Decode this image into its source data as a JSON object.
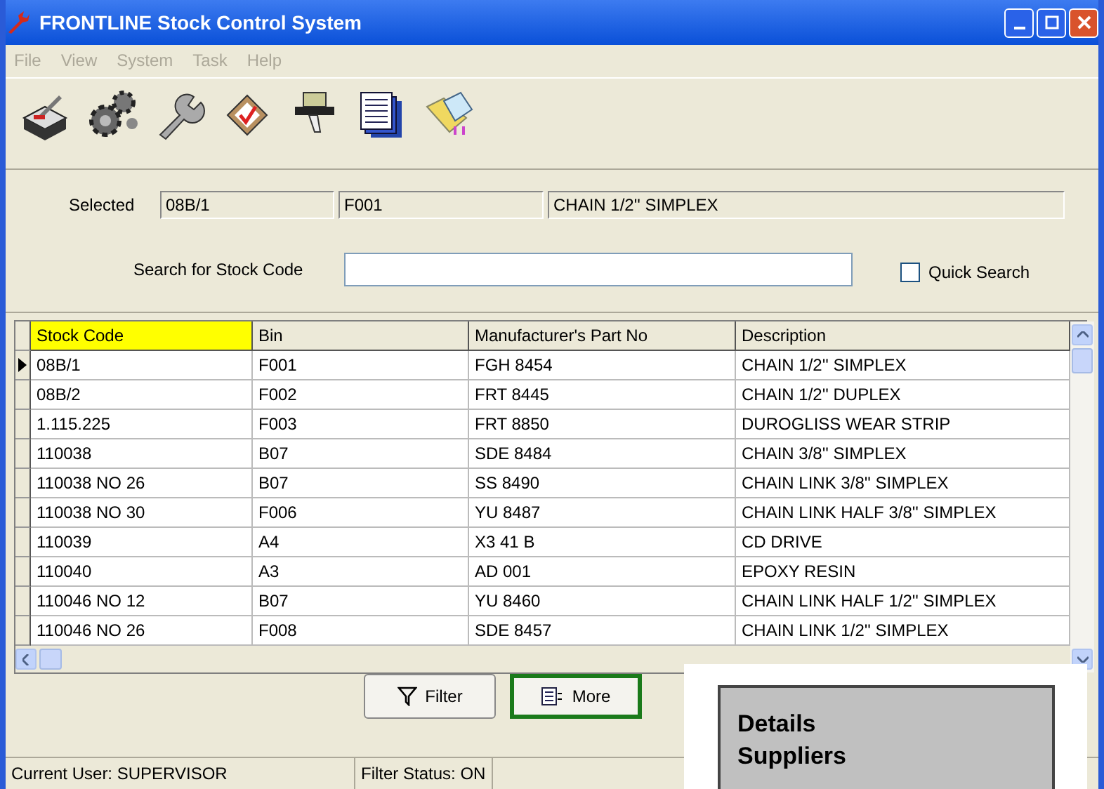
{
  "window": {
    "title": "FRONTLINE Stock Control System"
  },
  "menu": [
    "File",
    "View",
    "System",
    "Task",
    "Help"
  ],
  "selected": {
    "label": "Selected",
    "fields": [
      "08B/1",
      "F001",
      "CHAIN 1/2'' SIMPLEX"
    ]
  },
  "search": {
    "label": "Search for Stock Code",
    "quick_search": {
      "label": "Quick Search",
      "checked": false
    }
  },
  "table": {
    "columns": [
      {
        "label": "Stock Code",
        "sorted": true
      },
      {
        "label": "Bin",
        "sorted": false
      },
      {
        "label": "Manufacturer's Part No",
        "sorted": false
      },
      {
        "label": "Description",
        "sorted": false
      }
    ],
    "rows": [
      {
        "selected": true,
        "cells": [
          "08B/1",
          "F001",
          "FGH  8454",
          "CHAIN 1/2'' SIMPLEX"
        ]
      },
      {
        "selected": false,
        "cells": [
          "08B/2",
          "F002",
          "FRT  8445",
          "CHAIN 1/2'' DUPLEX"
        ]
      },
      {
        "selected": false,
        "cells": [
          "1.115.225",
          "F003",
          "FRT  8850",
          "DUROGLISS WEAR STRIP"
        ]
      },
      {
        "selected": false,
        "cells": [
          "110038",
          "B07",
          "SDE  8484",
          "CHAIN 3/8'' SIMPLEX"
        ]
      },
      {
        "selected": false,
        "cells": [
          "110038 NO 26",
          "B07",
          "SS  8490",
          "CHAIN LINK 3/8'' SIMPLEX"
        ]
      },
      {
        "selected": false,
        "cells": [
          "110038 NO 30",
          "F006",
          "YU  8487",
          "CHAIN LINK HALF 3/8'' SIMPLEX"
        ]
      },
      {
        "selected": false,
        "cells": [
          "110039",
          "A4",
          "X3 41 B",
          "CD DRIVE"
        ]
      },
      {
        "selected": false,
        "cells": [
          "110040",
          "A3",
          "AD 001",
          "EPOXY RESIN"
        ]
      },
      {
        "selected": false,
        "cells": [
          "110046 NO 12",
          "B07",
          "YU  8460",
          "CHAIN LINK HALF 1/2'' SIMPLEX"
        ]
      },
      {
        "selected": false,
        "cells": [
          "110046 NO 26",
          "F008",
          "SDE  8457",
          "CHAIN LINK 1/2'' SIMPLEX"
        ]
      }
    ]
  },
  "buttons": [
    {
      "kind": "filter",
      "label": "Filter",
      "focused": false
    },
    {
      "kind": "more",
      "label": "More",
      "focused": true
    }
  ],
  "status_bar": [
    "Current User: SUPERVISOR",
    "Filter Status: ON"
  ],
  "popup_menu": [
    "Details",
    "Suppliers"
  ]
}
